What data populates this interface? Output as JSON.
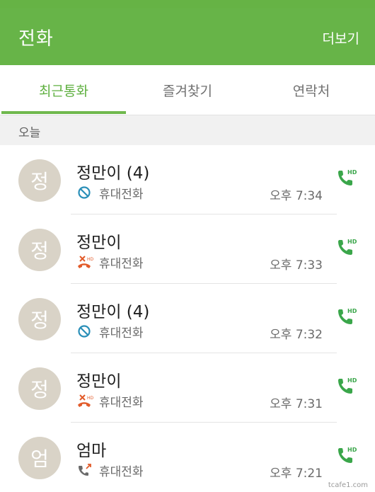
{
  "app": {
    "title": "전화",
    "more_label": "더보기"
  },
  "tabs": [
    {
      "label": "최근통화",
      "active": true
    },
    {
      "label": "즐겨찾기",
      "active": false
    },
    {
      "label": "연락처",
      "active": false
    }
  ],
  "section": {
    "label": "오늘"
  },
  "calls": [
    {
      "avatar": "정",
      "name": "정만이 (4)",
      "type_icon": "blocked-icon",
      "type_label": "휴대전화",
      "time": "오후 7:34"
    },
    {
      "avatar": "정",
      "name": "정만이",
      "type_icon": "rejected-call-icon",
      "type_label": "휴대전화",
      "time": "오후 7:33"
    },
    {
      "avatar": "정",
      "name": "정만이 (4)",
      "type_icon": "blocked-icon",
      "type_label": "휴대전화",
      "time": "오후 7:32"
    },
    {
      "avatar": "정",
      "name": "정만이",
      "type_icon": "rejected-call-icon",
      "type_label": "휴대전화",
      "time": "오후 7:31"
    },
    {
      "avatar": "엄",
      "name": "엄마",
      "type_icon": "outgoing-call-icon",
      "type_label": "휴대전화",
      "time": "오후 7:21"
    }
  ],
  "call_button": {
    "badge": "HD",
    "icon": "hd-call-icon"
  },
  "watermark": "tcafe1.com",
  "colors": {
    "accent": "#67b448",
    "blocked": "#2a8fb8",
    "rejected": "#e25b2a",
    "avatar_bg": "#d9d3c7"
  }
}
